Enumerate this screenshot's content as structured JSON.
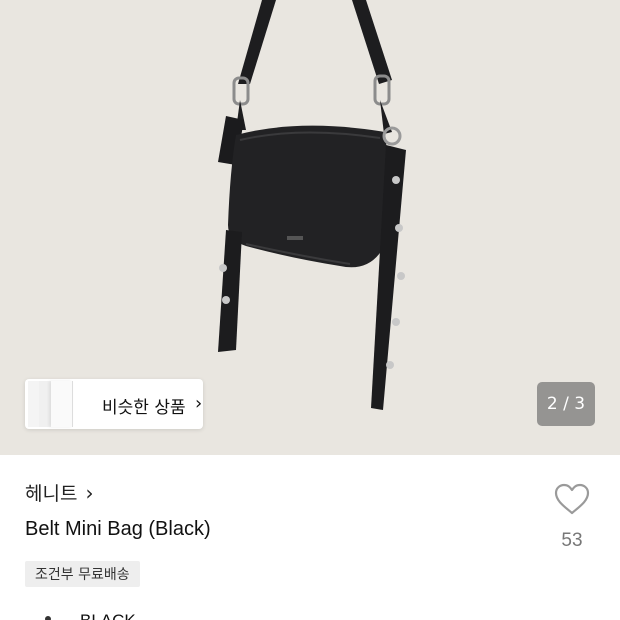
{
  "gallery": {
    "similar_label": "비슷한 상품",
    "counter": "2 / 3",
    "image_alt": "black mini shoulder bag with belt strap"
  },
  "product": {
    "brand": "헤니트",
    "title": "Belt Mini Bag (Black)",
    "shipping_badge": "조건부 무료배송",
    "like_count": "53",
    "option_label": "BLACK"
  },
  "icons": {
    "chevron": "chevron-right-icon",
    "heart": "heart-icon"
  }
}
